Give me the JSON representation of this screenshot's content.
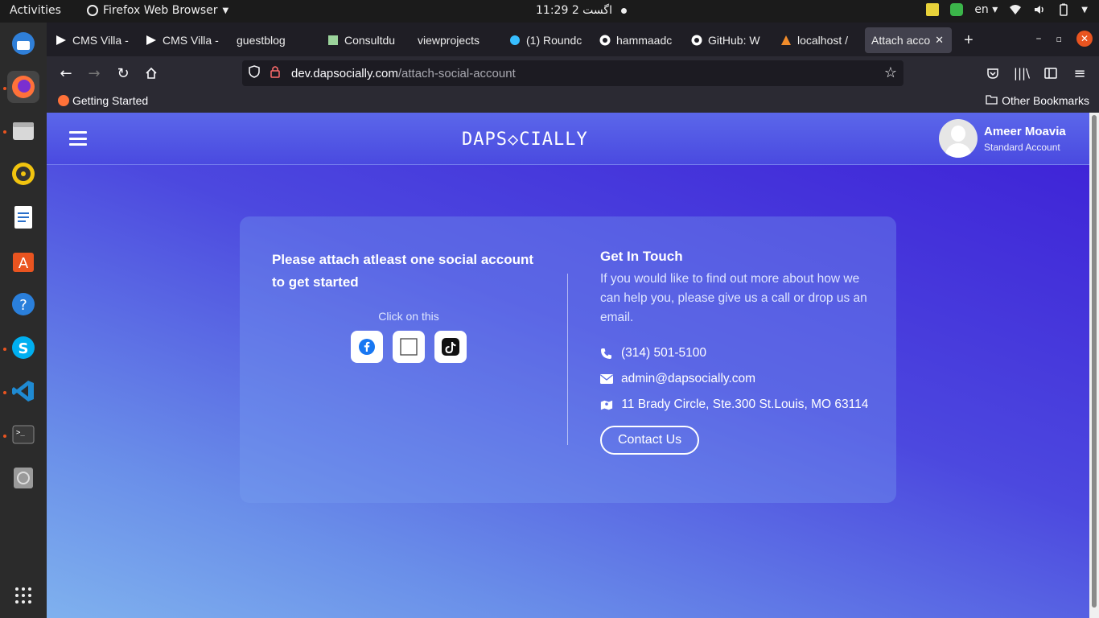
{
  "system": {
    "activities": "Activities",
    "app_menu": "Firefox Web Browser",
    "clock": "اگست 2  11:29",
    "language": "en"
  },
  "dock": {
    "items": [
      "thunderbird-icon",
      "firefox-icon",
      "files-icon",
      "rhythmbox-icon",
      "writer-icon",
      "software-icon",
      "help-icon",
      "skype-icon",
      "vscode-icon",
      "terminal-icon",
      "disc-icon",
      "app-grid-icon"
    ]
  },
  "browser": {
    "tabs": [
      {
        "label": "CMS Villa -"
      },
      {
        "label": "CMS Villa -"
      },
      {
        "label": "guestblog"
      },
      {
        "label": "Consultdu"
      },
      {
        "label": "viewprojects"
      },
      {
        "label": "(1) Roundc"
      },
      {
        "label": "hammaadc"
      },
      {
        "label": "GitHub: W"
      },
      {
        "label": "localhost /"
      },
      {
        "label": "Attach acco"
      }
    ],
    "url_host": "dev.dapsocially.com",
    "url_path": "/attach-social-account",
    "bookmark_getting_started": "Getting Started",
    "bookmark_other": "Other Bookmarks"
  },
  "site": {
    "logo": "DAPS◇CIALLY",
    "profile_name": "Ameer Moavia",
    "profile_account": "Standard Account"
  },
  "card": {
    "title": "Please attach atleast one social account to get started",
    "click_label": "Click on this",
    "touch_title": "Get In Touch",
    "touch_desc": "If you would like to find out more about how we can help you, please give us a call or drop us an email.",
    "phone": "(314) 501-5100",
    "email": "admin@dapsocially.com",
    "address": "11 Brady Circle, Ste.300 St.Louis, MO 63114",
    "contact_button": "Contact Us"
  }
}
